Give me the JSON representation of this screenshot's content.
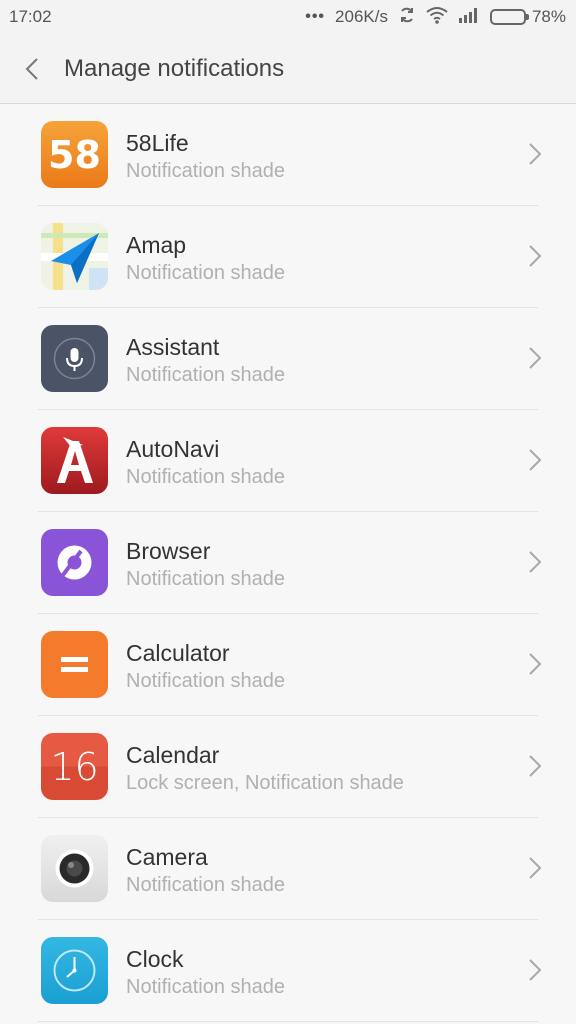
{
  "status_bar": {
    "time": "17:02",
    "dots": "•••",
    "speed": "206K/s",
    "sync_icon": "sync-icon",
    "wifi_icon": "wifi-icon",
    "signal_icon": "signal-icon",
    "battery_percent": "78%",
    "battery_level": 0.78
  },
  "header": {
    "back_icon": "chevron-left-icon",
    "title": "Manage notifications"
  },
  "apps": [
    {
      "name": "58Life",
      "sub": "Notification shade",
      "icon": "58life-icon"
    },
    {
      "name": "Amap",
      "sub": "Notification shade",
      "icon": "amap-icon"
    },
    {
      "name": "Assistant",
      "sub": "Notification shade",
      "icon": "microphone-icon"
    },
    {
      "name": "AutoNavi",
      "sub": "Notification shade",
      "icon": "autonavi-icon"
    },
    {
      "name": "Browser",
      "sub": "Notification shade",
      "icon": "browser-icon"
    },
    {
      "name": "Calculator",
      "sub": "Notification shade",
      "icon": "calculator-icon"
    },
    {
      "name": "Calendar",
      "sub": "Lock screen, Notification shade",
      "icon": "calendar-icon",
      "icon_text": "16"
    },
    {
      "name": "Camera",
      "sub": "Notification shade",
      "icon": "camera-icon"
    },
    {
      "name": "Clock",
      "sub": "Notification shade",
      "icon": "clock-icon"
    }
  ],
  "icon_text_58life": "58",
  "colors": {
    "58life": "#f08a24",
    "assistant": "#4b5366",
    "autonavi": "#c8262b",
    "browser": "#8a54d8",
    "calculator": "#f47a2c",
    "calendar": "#e2523c",
    "clock": "#20a9d8"
  }
}
